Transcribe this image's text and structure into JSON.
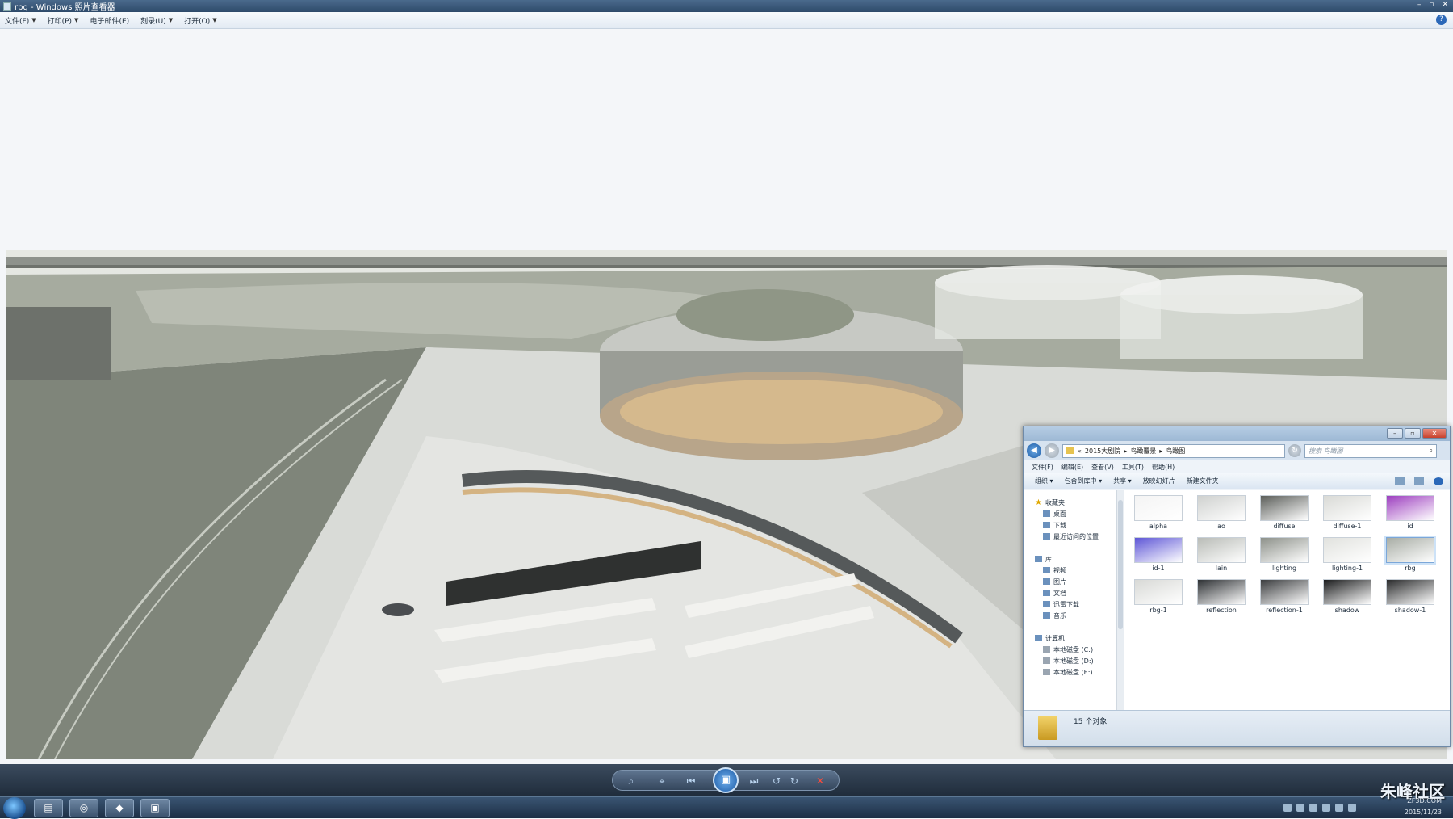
{
  "window": {
    "title": "rbg - Windows 照片查看器",
    "min": "–",
    "max": "▫",
    "close": "✕"
  },
  "menu": [
    {
      "label": "文件(F)"
    },
    {
      "label": "打印(P)"
    },
    {
      "label": "电子邮件(E)"
    },
    {
      "label": "刻录(U)"
    },
    {
      "label": "打开(O)"
    }
  ],
  "help": "?",
  "player": {
    "zoom": "⌕",
    "fit": "⌖",
    "prev": "⏮",
    "play": "▣",
    "next": "⏭",
    "rotate_ccw": "↺",
    "rotate_cw": "↻",
    "delete": "✕"
  },
  "explorer": {
    "address": [
      "«",
      "2015大剧院",
      "▸",
      "鸟瞰覆景",
      "▸",
      "鸟瞰图"
    ],
    "search_placeholder": "搜索 鸟瞰图",
    "menu": [
      "文件(F)",
      "编辑(E)",
      "查看(V)",
      "工具(T)",
      "帮助(H)"
    ],
    "commands": [
      "组织 ▾",
      "包含到库中 ▾",
      "共享 ▾",
      "放映幻灯片",
      "新建文件夹"
    ],
    "nav": {
      "favorites": "收藏夹",
      "favorites_items": [
        "桌面",
        "下载",
        "最近访问的位置"
      ],
      "libraries": "库",
      "library_items": [
        "视频",
        "图片",
        "文档",
        "迅雷下载",
        "音乐"
      ],
      "computer": "计算机",
      "drives": [
        "本地磁盘 (C:)",
        "本地磁盘 (D:)",
        "本地磁盘 (E:)"
      ]
    },
    "files": [
      {
        "name": "alpha",
        "color": "#f4f4f4"
      },
      {
        "name": "ao",
        "color": "#cfd1cf"
      },
      {
        "name": "diffuse",
        "color": "#5b5e5a"
      },
      {
        "name": "diffuse-1",
        "color": "#d9dad6"
      },
      {
        "name": "id",
        "color": "#9d3fbf"
      },
      {
        "name": "id-1",
        "color": "#5e56d6"
      },
      {
        "name": "lain",
        "color": "#b9bcb7"
      },
      {
        "name": "lighting",
        "color": "#8d918a"
      },
      {
        "name": "lighting-1",
        "color": "#e1e2de"
      },
      {
        "name": "rbg",
        "color": "#a8ada5"
      },
      {
        "name": "rbg-1",
        "color": "#d8d9d6"
      },
      {
        "name": "reflection",
        "color": "#2e3134"
      },
      {
        "name": "reflection-1",
        "color": "#3b3d3f"
      },
      {
        "name": "shadow",
        "color": "#1b1c1d"
      },
      {
        "name": "shadow-1",
        "color": "#2a2b2c"
      }
    ],
    "status": "15 个对象"
  },
  "watermark": "朱峰社区",
  "watermark_url": "ZF3D.COM",
  "date": "2015/11/23"
}
